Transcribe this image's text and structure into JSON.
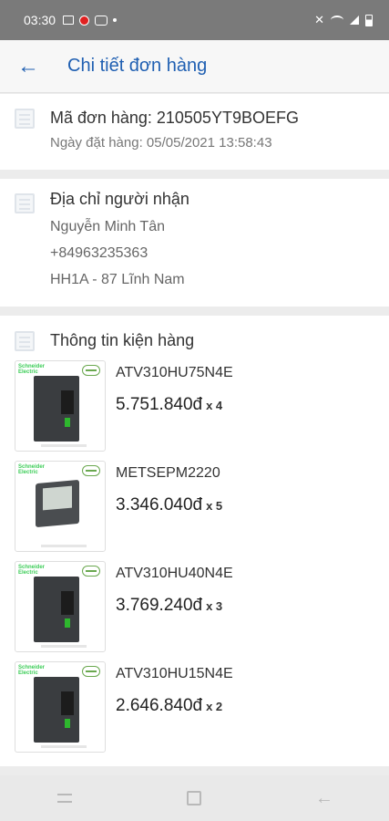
{
  "status": {
    "time": "03:30"
  },
  "header": {
    "title": "Chi tiết đơn hàng"
  },
  "order": {
    "code_line": "Mã đơn hàng: 210505YT9BOEFG",
    "date_line": "Ngày đặt hàng: 05/05/2021 13:58:43"
  },
  "address": {
    "title": "Địa chỉ người nhận",
    "name": "Nguyễn Minh Tân",
    "phone": "+84963235363",
    "street": "HH1A - 87 Lĩnh Nam"
  },
  "package": {
    "title": "Thông tin kiện hàng",
    "items": [
      {
        "name": "ATV310HU75N4E",
        "price": "5.751.840đ",
        "qty": "x 4"
      },
      {
        "name": "METSEPM2220",
        "price": "3.346.040đ",
        "qty": "x 5"
      },
      {
        "name": "ATV310HU40N4E",
        "price": "3.769.240đ",
        "qty": "x 3"
      },
      {
        "name": "ATV310HU15N4E",
        "price": "2.646.840đ",
        "qty": "x 2"
      }
    ]
  },
  "thumb_brand": "Schneider Electric",
  "colors": {
    "accent": "#1f5fb2",
    "status_bar": "#7a7a7a",
    "brand_green": "#3dcd58"
  }
}
